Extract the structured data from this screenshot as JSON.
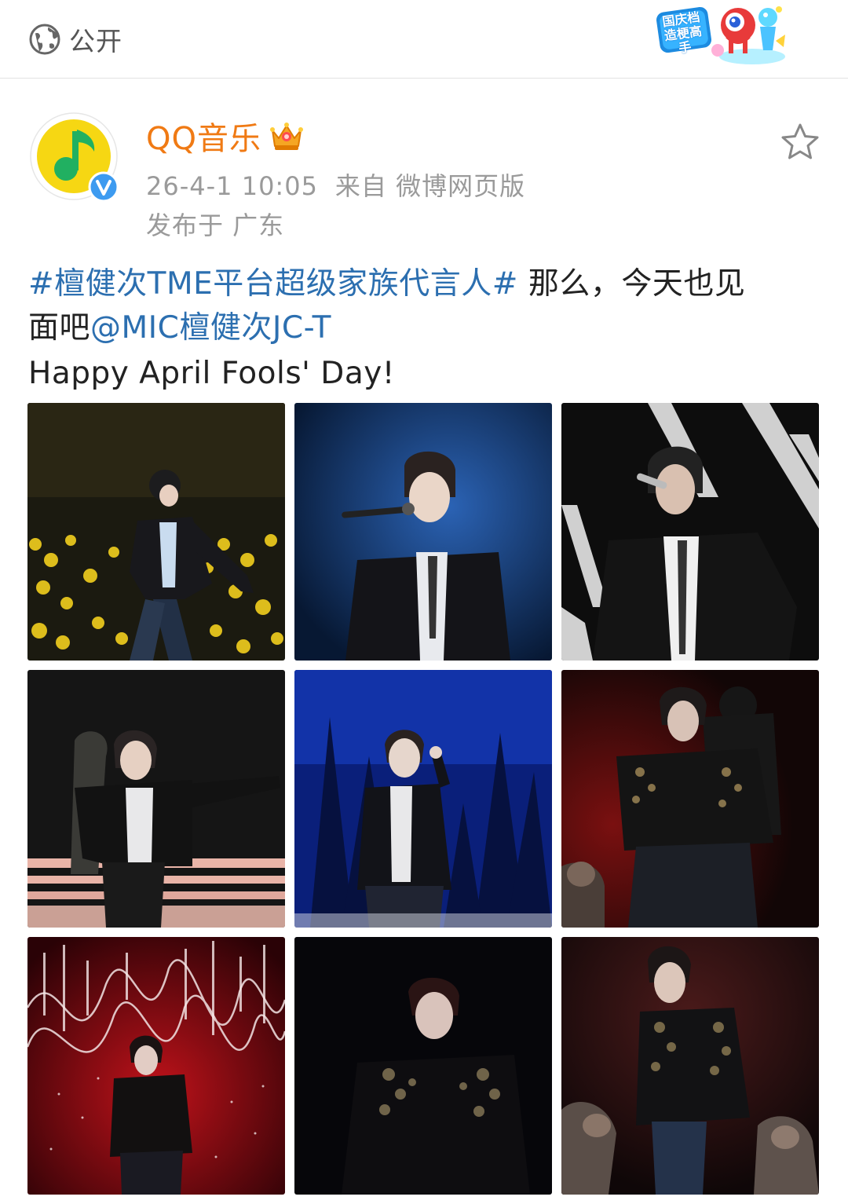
{
  "top_bar": {
    "visibility_label": "公开",
    "visibility_icon": "globe-icon",
    "event_badge": {
      "text": "国庆档 造梗高手",
      "icon": "mascot-icon"
    }
  },
  "post": {
    "author": {
      "name": "QQ音乐",
      "avatar_icon": "qq-music-logo-icon",
      "verified_icon": "verified-v-icon",
      "member_icon": "crown-icon"
    },
    "time": "26-4-1 10:05",
    "source": "来自 微博网页版",
    "location": "发布于 广东",
    "favorite_icon": "star-outline-icon",
    "text": {
      "hashtag": "#檀健次TME平台超级家族代言人#",
      "line1_rest": " 那么，今天也见",
      "line2_start": "面吧",
      "mention": "@MIC檀健次JC-T",
      "line3": "Happy April Fools' Day!"
    },
    "photos": [
      {
        "scene": "yellow-lightstick-crowd",
        "bg": "#1a1a10",
        "accent": "#e8c21a"
      },
      {
        "scene": "blue-stage-mic",
        "bg": "#0b2350",
        "accent": "#2a5fa8"
      },
      {
        "scene": "black-white-stripes-mic",
        "bg": "#101010",
        "accent": "#d8d8d8"
      },
      {
        "scene": "dark-stage-pointing",
        "bg": "#151515",
        "accent": "#e7b0a6"
      },
      {
        "scene": "blue-forest-gesture",
        "bg": "#0a1d6e",
        "accent": "#1e3c9c"
      },
      {
        "scene": "red-dancers-embrace",
        "bg": "#1a0808",
        "accent": "#7a1414"
      },
      {
        "scene": "red-soundwave-lights",
        "bg": "#3a0408",
        "accent": "#c01218"
      },
      {
        "scene": "black-stage-head-down",
        "bg": "#06060a",
        "accent": "#3a1010"
      },
      {
        "scene": "dark-red-dancers",
        "bg": "#180a0c",
        "accent": "#5a1c1c"
      }
    ]
  }
}
